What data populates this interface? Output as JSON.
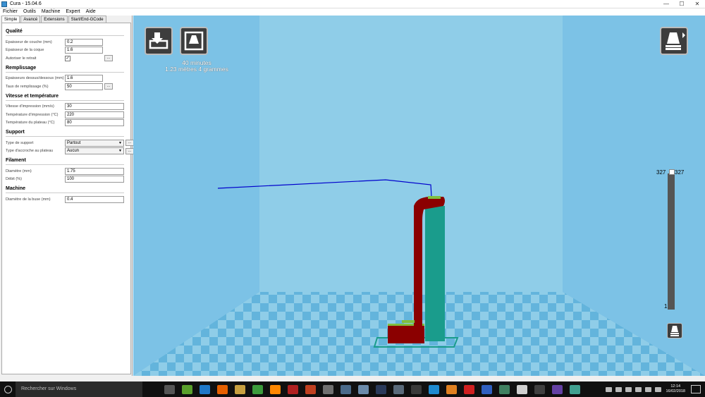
{
  "window": {
    "title": "Cura - 15.04.6",
    "icon": "cura-icon"
  },
  "window_controls": {
    "minimize": "—",
    "maximize": "☐",
    "close": "✕"
  },
  "menu": [
    "Fichier",
    "Outils",
    "Machine",
    "Expert",
    "Aide"
  ],
  "tabs": [
    "Simple",
    "Avancé",
    "Extensions",
    "Start/End-GCode"
  ],
  "sections": {
    "qualite": {
      "title": "Qualité",
      "layer_height_label": "Epaisseur de couche (mm)",
      "layer_height": "0.2",
      "shell_label": "Epaisseur de la coque",
      "shell": "1.6",
      "retraction_label": "Autoriser le retrait",
      "retraction_checked": "✓",
      "more": "..."
    },
    "remplissage": {
      "title": "Remplissage",
      "topbottom_label": "Epaisseurs dessus/dessous (mm)",
      "topbottom": "1.6",
      "density_label": "Taux de remplissage (%)",
      "density": "50",
      "more": "..."
    },
    "vitesse": {
      "title": "Vitesse et température",
      "speed_label": "Vitesse d'impression (mm/s)",
      "speed": "30",
      "temp_label": "Température d'impression (°C)",
      "temp": "220",
      "bed_label": "Température du plateau (°C)",
      "bed": "80"
    },
    "support": {
      "title": "Support",
      "type_label": "Type de support",
      "type": "Partout",
      "adhesion_label": "Type d'accroche au plateau",
      "adhesion": "Aucun",
      "more": "..."
    },
    "filament": {
      "title": "Filament",
      "diameter_label": "Diamètre (mm)",
      "diameter": "1.75",
      "flow_label": "Débit (%)",
      "flow": "100"
    },
    "machine": {
      "title": "Machine",
      "nozzle_label": "Diamètre de la buse (mm)",
      "nozzle": "0.4"
    }
  },
  "viewport": {
    "print_time": "40 minutes",
    "print_material": "1.23 mètres 4 grammes",
    "layer_max_left": "327",
    "layer_max_right": "327",
    "layer_min": "1",
    "colors": {
      "background": "#72b8de",
      "wall_outer": "#8b0000",
      "wall_inner": "#1a9c8c",
      "travel": "#0000cc",
      "top": "#7fbf3f"
    }
  },
  "taskbar": {
    "search_placeholder": "Rechercher sur Windows",
    "time": "12:14",
    "date": "16/02/2018"
  }
}
